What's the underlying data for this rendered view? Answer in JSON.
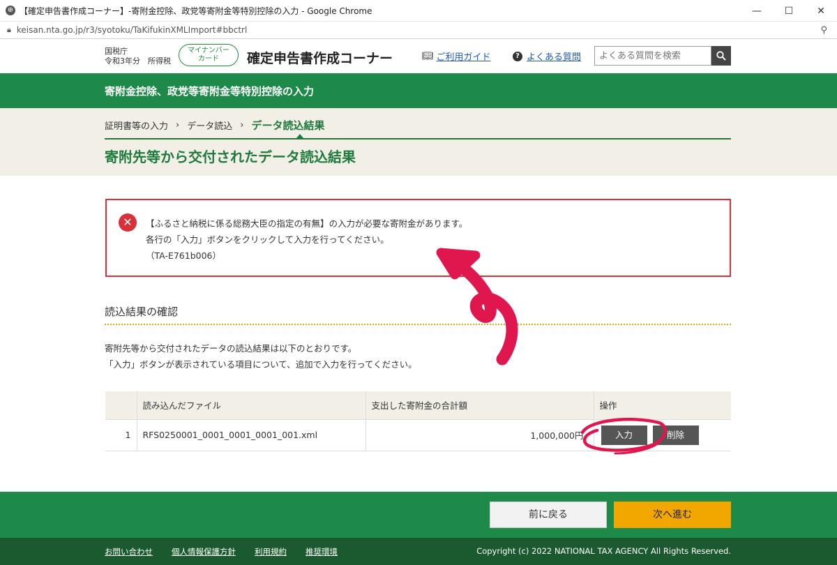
{
  "browser": {
    "window_title": "【確定申告書作成コーナー】-寄附金控除、政党等寄附金等特別控除の入力 - Google Chrome",
    "url": "keisan.nta.go.jp/r3/syotoku/TaKifukinXMLImport#bbctrl"
  },
  "header": {
    "agency": "国税庁",
    "year_label": "令和3年分　所得税",
    "mynumber_label_1": "マイナンバー",
    "mynumber_label_2": "カード",
    "site_title": "確定申告書作成コーナー",
    "guide_link": "ご利用ガイド",
    "faq_link": "よくある質問",
    "search_placeholder": "よくある質問を検索"
  },
  "band_title": "寄附金控除、政党等寄附金等特別控除の入力",
  "breadcrumb": {
    "items": [
      "証明書等の入力",
      "データ読込",
      "データ読込結果"
    ]
  },
  "page_title": "寄附先等から交付されたデータ読込結果",
  "error": {
    "line1": "【ふるさと納税に係る総務大臣の指定の有無】の入力が必要な寄附金があります。",
    "line2": "各行の「入力」ボタンをクリックして入力を行ってください。",
    "line3": "（TA-E761b006）"
  },
  "section": {
    "title": "読込結果の確認",
    "desc1": "寄附先等から交付されたデータの読込結果は以下のとおりです。",
    "desc2": "「入力」ボタンが表示されている項目について、追加で入力を行ってください。"
  },
  "table": {
    "headers": [
      "",
      "読み込んだファイル",
      "支出した寄附金の合計額",
      "操作"
    ],
    "rows": [
      {
        "no": "1",
        "file": "RFS0250001_0001_0001_0001_001.xml",
        "amount": "1,000,000円",
        "input_label": "入力",
        "delete_label": "削除"
      }
    ]
  },
  "nav": {
    "back_label": "前に戻る",
    "next_label": "次へ進む"
  },
  "footer": {
    "links": [
      "お問い合わせ",
      "個人情報保護方針",
      "利用規約",
      "推奨環境"
    ],
    "copyright": "Copyright (c) 2022 NATIONAL TAX AGENCY All Rights Reserved."
  },
  "colors": {
    "brand_green": "#1e8a4a",
    "error_red": "#d9313a",
    "next_orange": "#f2a700",
    "annotation_red": "#e0174f"
  },
  "icons": [
    "globe-icon",
    "lock-icon",
    "book-icon",
    "question-icon",
    "search-icon",
    "error-icon",
    "location-icon"
  ]
}
